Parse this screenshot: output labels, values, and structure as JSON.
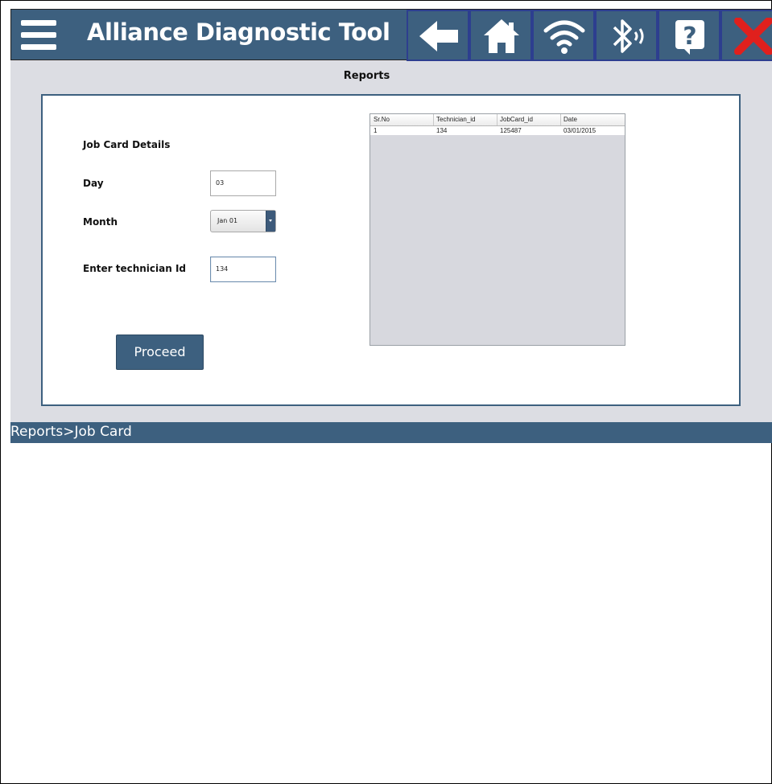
{
  "header": {
    "app_title": "Alliance Diagnostic Tool",
    "toolbar_icons": [
      "back-arrow-icon",
      "home-icon",
      "wifi-icon",
      "bluetooth-icon",
      "help-icon",
      "close-icon"
    ]
  },
  "page": {
    "title": "Reports",
    "section_title": "Job Card Details"
  },
  "form": {
    "day_label": "Day",
    "day_value": "03",
    "month_label": "Month",
    "month_value": "Jan 01",
    "technician_label": "Enter technician Id",
    "technician_value": "134",
    "proceed_label": "Proceed"
  },
  "table": {
    "columns": [
      "Sr.No",
      "Technician_id",
      "JobCard_id",
      "Date"
    ],
    "rows": [
      [
        "1",
        "134",
        "125487",
        "03/01/2015"
      ]
    ]
  },
  "status_bar": {
    "breadcrumb": "Reports>Job Card"
  },
  "colors": {
    "primary": "#3d607f",
    "background": "#dcdde3",
    "close_red": "#e0201d"
  }
}
